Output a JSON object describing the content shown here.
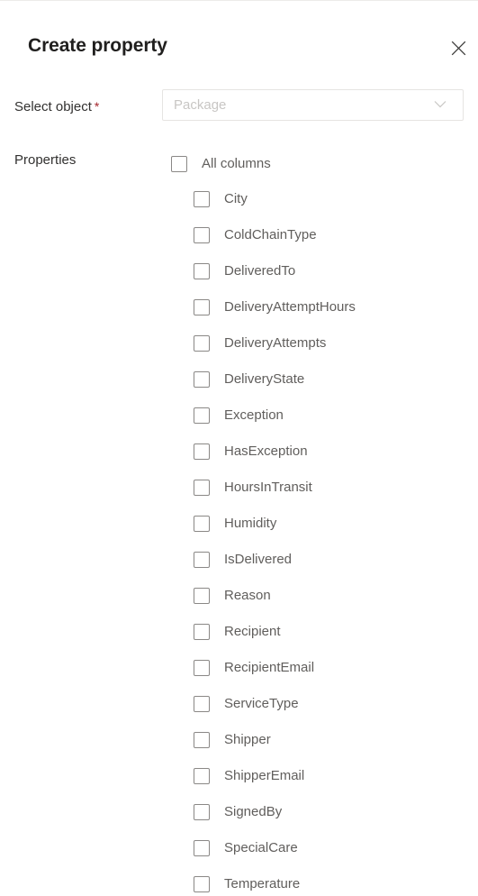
{
  "panel": {
    "title": "Create property",
    "close_icon": "close-icon"
  },
  "form": {
    "select_object": {
      "label": "Select object",
      "required_marker": "*",
      "dropdown": {
        "value": "",
        "placeholder": "Package",
        "chevron_icon": "chevron-down-icon"
      }
    },
    "properties": {
      "label": "Properties",
      "select_all": {
        "label": "All columns",
        "checked": false
      },
      "items": [
        {
          "label": "City",
          "checked": false
        },
        {
          "label": "ColdChainType",
          "checked": false
        },
        {
          "label": "DeliveredTo",
          "checked": false
        },
        {
          "label": "DeliveryAttemptHours",
          "checked": false
        },
        {
          "label": "DeliveryAttempts",
          "checked": false
        },
        {
          "label": "DeliveryState",
          "checked": false
        },
        {
          "label": "Exception",
          "checked": false
        },
        {
          "label": "HasException",
          "checked": false
        },
        {
          "label": "HoursInTransit",
          "checked": false
        },
        {
          "label": "Humidity",
          "checked": false
        },
        {
          "label": "IsDelivered",
          "checked": false
        },
        {
          "label": "Reason",
          "checked": false
        },
        {
          "label": "Recipient",
          "checked": false
        },
        {
          "label": "RecipientEmail",
          "checked": false
        },
        {
          "label": "ServiceType",
          "checked": false
        },
        {
          "label": "Shipper",
          "checked": false
        },
        {
          "label": "ShipperEmail",
          "checked": false
        },
        {
          "label": "SignedBy",
          "checked": false
        },
        {
          "label": "SpecialCare",
          "checked": false
        },
        {
          "label": "Temperature",
          "checked": false
        }
      ]
    }
  },
  "colors": {
    "title_text": "#201f1e",
    "label_text": "#323130",
    "item_text": "#605e5c",
    "placeholder_text": "#c8c6c4",
    "required_red": "#a4262c",
    "border": "#8a8886",
    "input_border": "#e6e4e2",
    "panel_divider": "#edebe9"
  }
}
